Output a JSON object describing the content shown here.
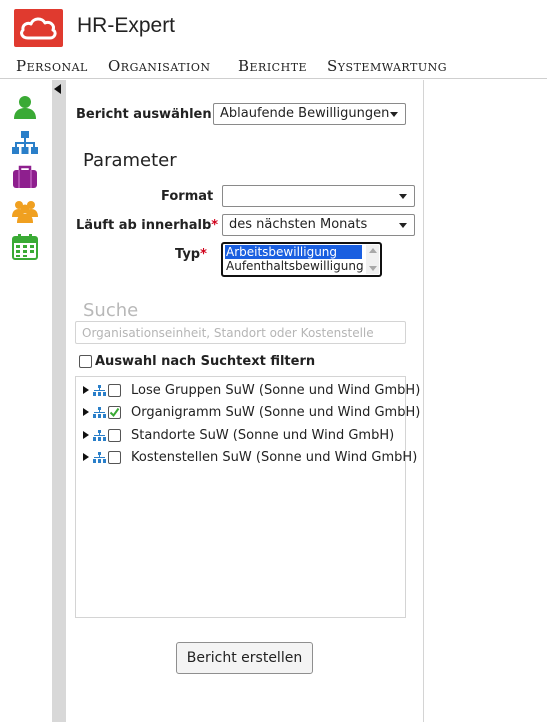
{
  "app": {
    "title": "HR-Expert",
    "logo_icon": "cloud-icon",
    "brand_color": "#e03a2f"
  },
  "menu": {
    "items": [
      "Personal",
      "Organisation",
      "Berichte",
      "Systemwartung"
    ]
  },
  "sidebar": {
    "icons": [
      {
        "name": "person-icon",
        "color": "#3aaa35"
      },
      {
        "name": "org-chart-icon",
        "color": "#2a7fc9"
      },
      {
        "name": "briefcase-icon",
        "color": "#8e1f8e"
      },
      {
        "name": "group-icon",
        "color": "#f0a020"
      },
      {
        "name": "calendar-icon",
        "color": "#3aaa35"
      }
    ]
  },
  "report": {
    "label": "Bericht auswählen",
    "selected": "Ablaufende Bewilligungen"
  },
  "parameters": {
    "title": "Parameter",
    "format": {
      "label": "Format",
      "value": ""
    },
    "expires": {
      "label": "Läuft ab innerhalb",
      "required_mark": "*",
      "value": "des nächsten Monats"
    },
    "type": {
      "label": "Typ",
      "required_mark": "*",
      "options": [
        {
          "label": "Arbeitsbewilligung",
          "selected": true
        },
        {
          "label": "Aufenthaltsbewilligung",
          "selected": false
        }
      ]
    }
  },
  "search": {
    "title": "Suche",
    "placeholder": "Organisationseinheit, Standort oder Kostenstelle",
    "filter_label": "Auswahl nach Suchtext filtern",
    "filter_checked": false
  },
  "tree": {
    "items": [
      {
        "label": "Lose Gruppen SuW (Sonne und Wind GmbH)",
        "checked": false
      },
      {
        "label": "Organigramm SuW (Sonne und Wind GmbH)",
        "checked": true
      },
      {
        "label": "Standorte SuW (Sonne und Wind GmbH)",
        "checked": false
      },
      {
        "label": "Kostenstellen SuW (Sonne und Wind GmbH)",
        "checked": false
      }
    ]
  },
  "actions": {
    "create_label": "Bericht erstellen"
  }
}
